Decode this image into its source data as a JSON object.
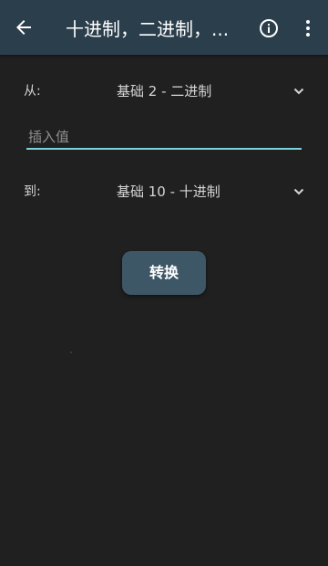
{
  "appbar": {
    "title": "十进制，二进制，...",
    "back_icon": "arrow-left-icon",
    "info_icon": "info-circle-icon",
    "more_icon": "more-vert-icon"
  },
  "from": {
    "label": "从:",
    "selected": "基础 2 - 二进制"
  },
  "input": {
    "placeholder": "插入值",
    "value": ""
  },
  "to": {
    "label": "到:",
    "selected": "基础 10 - 十进制"
  },
  "convert_button": {
    "label": "转换"
  },
  "colors": {
    "appbar_bg": "#2b3e4b",
    "background": "#202020",
    "accent_underline": "#7ad3da",
    "button_bg": "#3e5766",
    "text": "#d6d6d6"
  }
}
